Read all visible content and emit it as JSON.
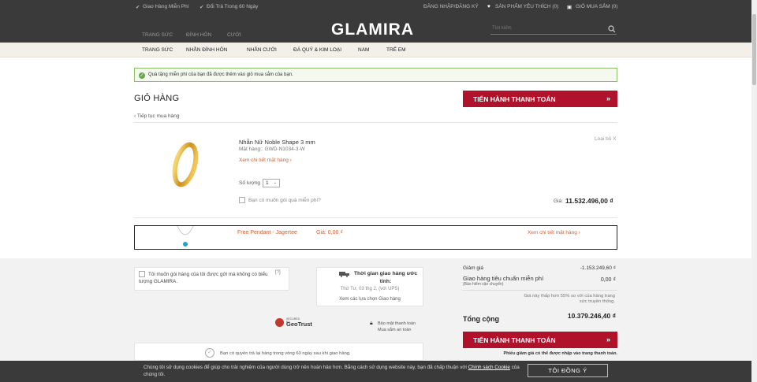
{
  "topbar": {
    "free_shipping": "Giao Hàng Miễn Phí",
    "returns": "Đổi Trả Trong 60 Ngày",
    "login": "ĐĂNG NHẬP/ĐĂNG KÝ",
    "wishlist": "SẢN PHẨM YÊU THÍCH (0)",
    "cart": "GIỎ MUA SẮM (0)"
  },
  "header": {
    "logo": "GLAMIRA",
    "subnav": [
      "TRANG SỨC",
      "ĐÍNH HÔN",
      "CƯỚI"
    ],
    "search_placeholder": "Tìm kiếm"
  },
  "mainnav": [
    "TRANG SỨC",
    "NHẪN ĐÍNH HÔN",
    "NHẪN CƯỚI",
    "ĐÁ QUÝ & KIM LOẠI",
    "NAM",
    "TRẺ EM"
  ],
  "alert": "Quà tặng miễn phí của bạn đã được thêm vào giỏ mua sắm của bạn.",
  "cart": {
    "title": "GIỎ HÀNG",
    "checkout": "TIẾN HÀNH THANH TOÁN",
    "checkout_arrow": "»",
    "back": "‹ Tiếp tục mua hàng",
    "item": {
      "name": "Nhẫn Nữ Noble Shape 3 mm",
      "sku": "Mặt hàng:: GWD-N1034-3-W",
      "detail_link": "Xem chi tiết mặt hàng  ›",
      "remove": "Loại bỏ X",
      "qty_label": "Số lượng",
      "qty_value": "1",
      "gift_label": "Bạn có muốn gói quà miễn phí?",
      "price_label": "Giá:",
      "price": "11.532.496,00 ₫"
    },
    "free_item": {
      "name": "Free Pendant - Jagertee",
      "price": "Giá: 0,00 ₫",
      "detail_link": "Xem chi tiết mặt hàng  ›"
    }
  },
  "lower": {
    "gift_option": "Tôi muốn gói hàng của tôi được gửi mà không có biểu tượng GLAMIRA.",
    "help": "[?]",
    "delivery_title": "Thời gian giao hàng ước tính:",
    "delivery_date": "Thứ Tư, 03 thg 2, (với UPS)",
    "delivery_link": "Xem các lựa chọn Giao hàng",
    "secured_by": "SECURED BY",
    "geotrust": "GeoTrust",
    "security_note": "Bảo mật thanh toán\nMua sắm an toàn",
    "returns_note": "Bạn có quyền trả lại hàng trong vòng 60 ngày sau khi giao hàng.",
    "summary": {
      "discount_label": "Giảm giá",
      "discount_value": "-1.153.249,60 ₫",
      "shipping_label": "Giao hàng tiêu chuẩn miễn phí",
      "shipping_sub": "(Bảo hiểm vận chuyển)",
      "shipping_value": "0,00 ₫",
      "note": "Giá này thấp hơn 55% so với của hàng trang sức truyền thống.",
      "total_label": "Tổng cộng",
      "total_value": "10.379.246,40 ₫",
      "payment_note": "Phiếu giảm giá có thể được nhập vào trang thanh toán."
    }
  },
  "cookie": {
    "text": "Chúng tôi sử dụng cookies để giúp cho trải nghiệm của người dùng trở nên hoàn hảo hơn. Bằng cách sử dụng website này, bạn đã chấp thuận với",
    "policy": "Chính sách Cookie",
    "text_end": "của chúng tôi.",
    "button": "TÔI ĐỒNG Ý"
  }
}
